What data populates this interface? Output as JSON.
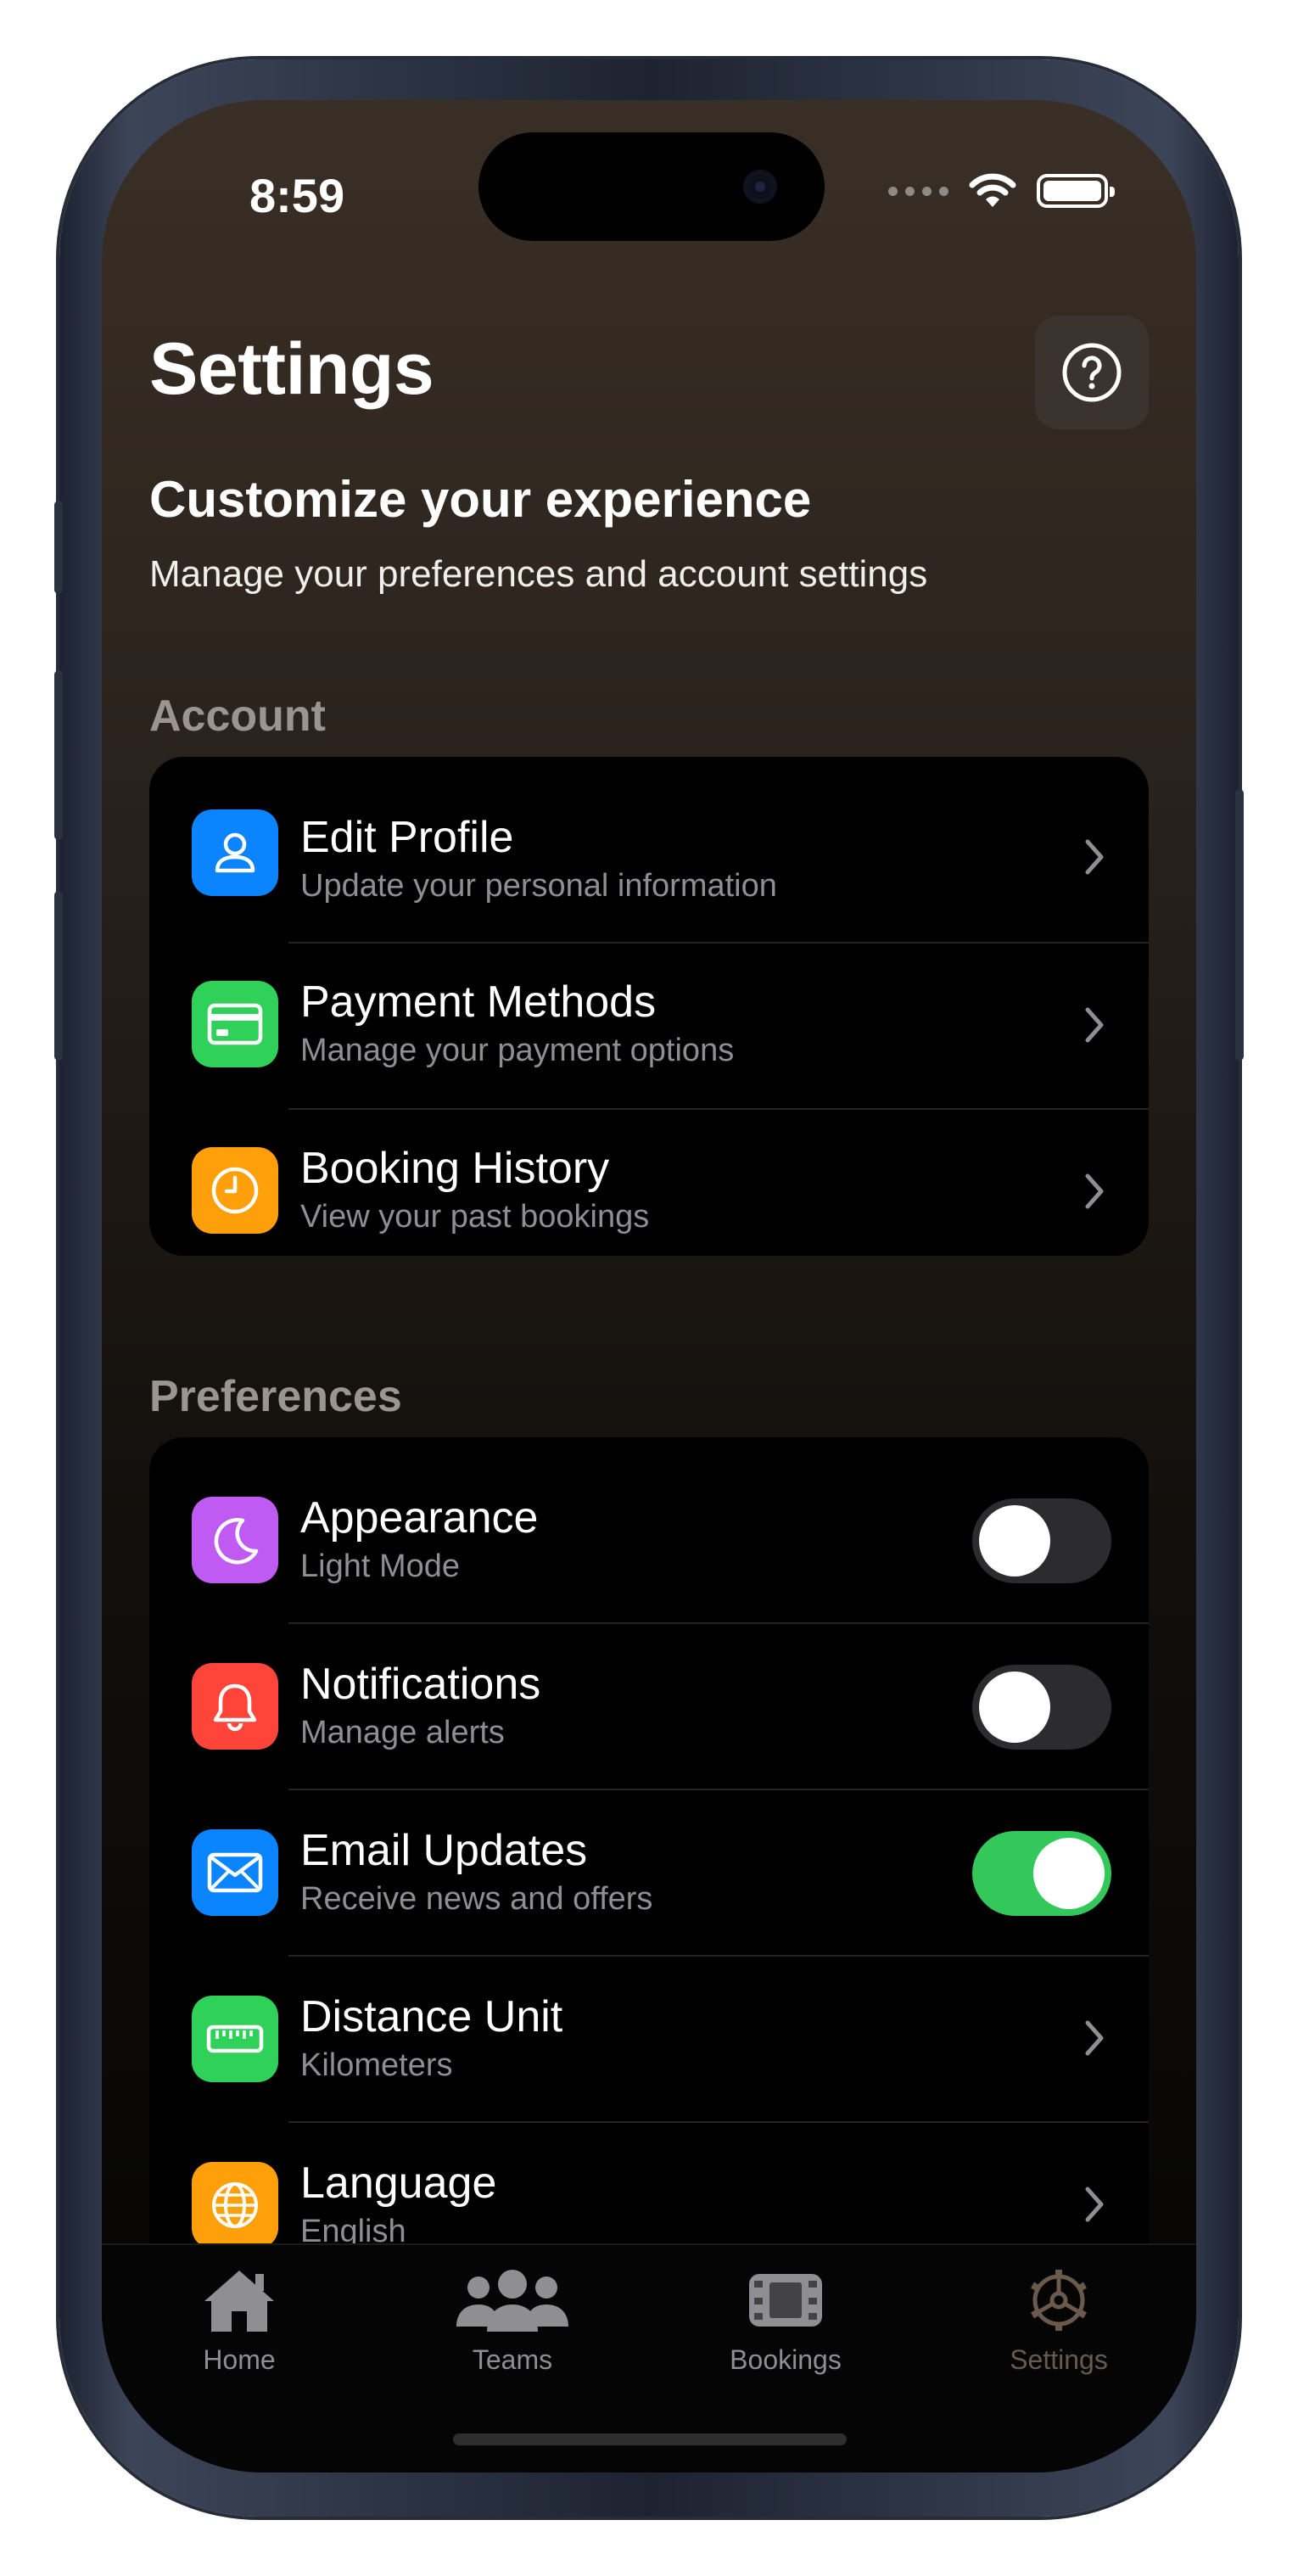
{
  "status_bar": {
    "time": "8:59"
  },
  "header": {
    "title": "Settings",
    "help_icon": "question-circle-icon",
    "subtitle": "Customize your experience",
    "description": "Manage your preferences and account settings"
  },
  "account": {
    "title": "Account",
    "items": [
      {
        "title": "Edit Profile",
        "subtitle": "Update your personal information",
        "icon": "person-icon",
        "icon_color": "#0a84ff"
      },
      {
        "title": "Payment Methods",
        "subtitle": "Manage your payment options",
        "icon": "credit-card-icon",
        "icon_color": "#30d158"
      },
      {
        "title": "Booking History",
        "subtitle": "View your past bookings",
        "icon": "clock-icon",
        "icon_color": "#ff9f0a"
      }
    ]
  },
  "preferences": {
    "title": "Preferences",
    "items": [
      {
        "title": "Appearance",
        "subtitle": "Light Mode",
        "icon": "moon-icon",
        "icon_color": "#bf5af2",
        "control": "toggle",
        "enabled": false
      },
      {
        "title": "Notifications",
        "subtitle": "Manage alerts",
        "icon": "bell-icon",
        "icon_color": "#ff453a",
        "control": "toggle",
        "enabled": false
      },
      {
        "title": "Email Updates",
        "subtitle": "Receive news and offers",
        "icon": "envelope-icon",
        "icon_color": "#0a84ff",
        "control": "toggle",
        "enabled": true
      },
      {
        "title": "Distance Unit",
        "subtitle": "Kilometers",
        "icon": "ruler-icon",
        "icon_color": "#30d158",
        "control": "chevron"
      },
      {
        "title": "Language",
        "subtitle": "English",
        "icon": "globe-icon",
        "icon_color": "#ff9f0a",
        "control": "chevron"
      }
    ]
  },
  "tab_bar": {
    "tabs": [
      {
        "label": "Home",
        "icon": "house-icon",
        "active": false
      },
      {
        "label": "Teams",
        "icon": "people-icon",
        "active": false
      },
      {
        "label": "Bookings",
        "icon": "film-icon",
        "active": false
      },
      {
        "label": "Settings",
        "icon": "gear-icon",
        "active": true
      }
    ],
    "active_color": "#6a5a4c",
    "inactive_color": "#8e8e93"
  }
}
